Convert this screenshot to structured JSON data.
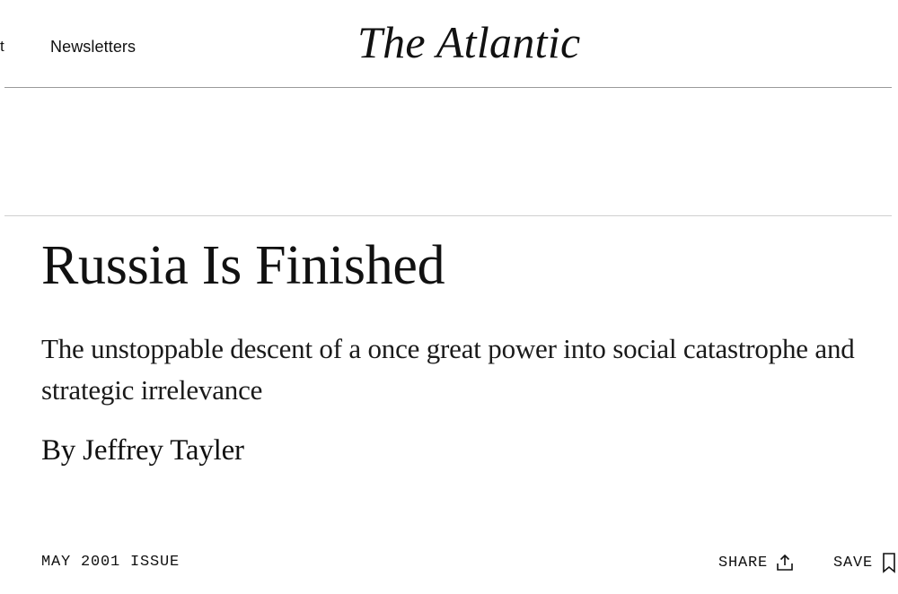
{
  "header": {
    "nav_cutoff_text": "t",
    "newsletters_label": "Newsletters",
    "logo_text": "The Atlantic"
  },
  "article": {
    "headline": "Russia Is Finished",
    "dek": "The unstoppable descent of a once great power into social catastrophe and strategic irrelevance",
    "byline_prefix": "By ",
    "author": "Jeffrey Tayler"
  },
  "meta_bar": {
    "issue": "MAY 2001 ISSUE",
    "share_label": "SHARE",
    "share_icon": "share-upload-icon",
    "save_label": "SAVE",
    "save_icon": "bookmark-icon"
  },
  "colors": {
    "text": "#111111",
    "rule": "#9a9a9a",
    "background": "#ffffff"
  }
}
